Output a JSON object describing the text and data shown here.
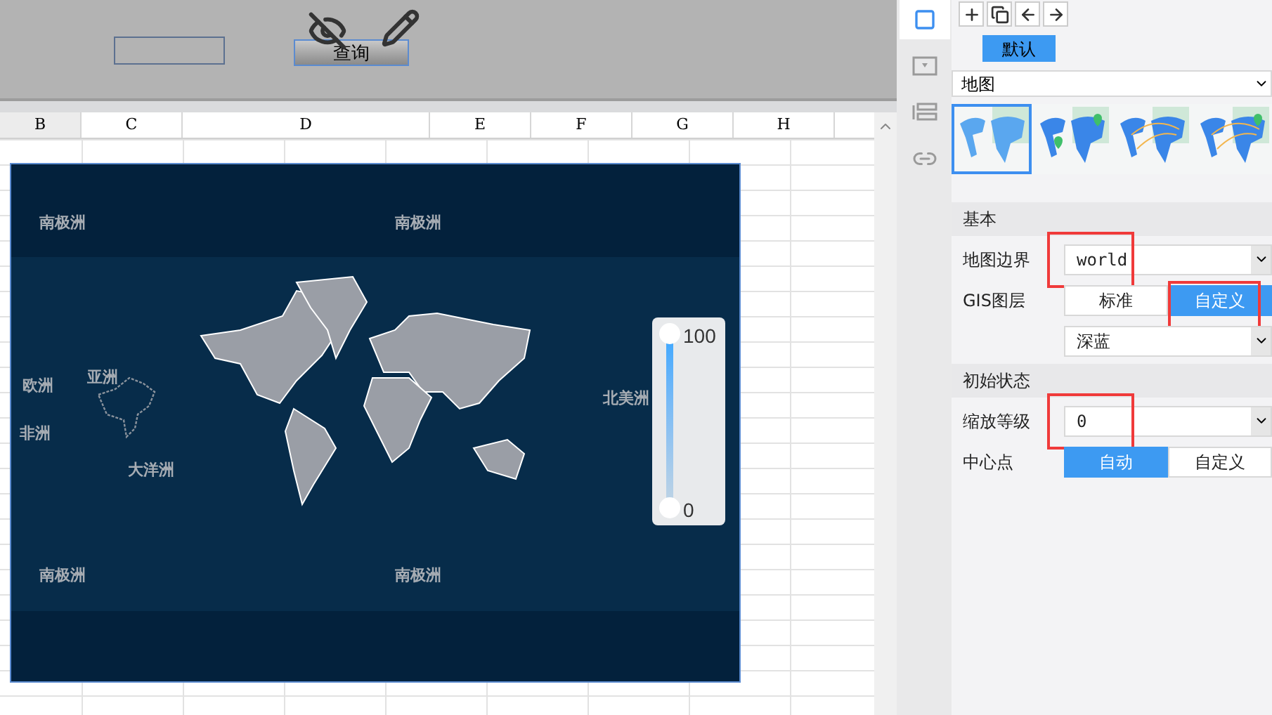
{
  "toolbar": {
    "query_button": "查询"
  },
  "sheet": {
    "columns": [
      "B",
      "C",
      "D",
      "E",
      "F",
      "G",
      "H"
    ]
  },
  "map": {
    "labels": [
      {
        "text": "南极洲"
      },
      {
        "text": "南极洲"
      },
      {
        "text": "欧洲"
      },
      {
        "text": "亚洲"
      },
      {
        "text": "非洲"
      },
      {
        "text": "大洋洲"
      },
      {
        "text": "北美洲"
      },
      {
        "text": "南极洲"
      },
      {
        "text": "南极洲"
      }
    ],
    "legend": {
      "max": "100",
      "min": "0"
    }
  },
  "side_icons": [
    {
      "kind": "cell",
      "selected": true
    },
    {
      "kind": "widget",
      "selected": false
    },
    {
      "kind": "layout",
      "selected": false
    },
    {
      "kind": "link",
      "selected": false
    }
  ],
  "panel": {
    "tabs": [
      {
        "label": "默认",
        "selected": true
      }
    ],
    "chart_type": "地图",
    "thumbnails": [
      {
        "kind": "plain",
        "selected": true
      },
      {
        "kind": "pins",
        "selected": false
      },
      {
        "kind": "lines",
        "selected": false
      },
      {
        "kind": "lines_pin",
        "selected": false
      }
    ],
    "sections": [
      {
        "title": "基本",
        "rows": [
          {
            "kind": "select",
            "label": "地图边界",
            "value": "world",
            "highlight": true
          },
          {
            "kind": "segmented",
            "label": "GIS图层",
            "options": [
              {
                "label": "标准",
                "selected": false
              },
              {
                "label": "自定义",
                "selected": true
              }
            ],
            "highlight": true
          },
          {
            "kind": "select",
            "value": "深蓝",
            "highlight": false
          }
        ]
      },
      {
        "title": "初始状态",
        "rows": [
          {
            "kind": "select",
            "label": "缩放等级",
            "value": "0",
            "highlight": true
          },
          {
            "kind": "segmented",
            "label": "中心点",
            "options": [
              {
                "label": "自动",
                "selected": true
              },
              {
                "label": "自定义",
                "selected": false
              }
            ],
            "highlight": false
          }
        ]
      }
    ]
  }
}
